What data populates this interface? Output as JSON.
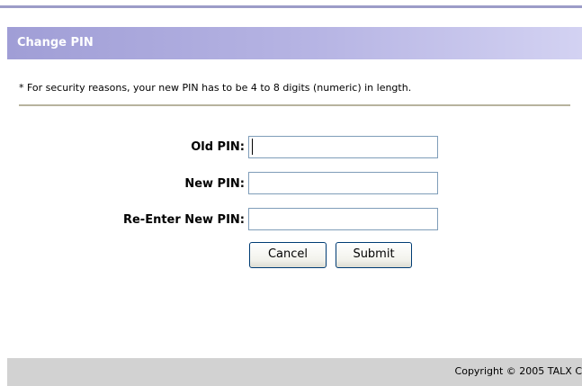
{
  "section": {
    "title": "Change PIN"
  },
  "note": "* For security reasons, your new PIN has to be 4 to 8 digits (numeric) in length.",
  "form": {
    "old_pin_label": "Old PIN:",
    "old_pin_value": "",
    "new_pin_label": "New PIN:",
    "new_pin_value": "",
    "reenter_label": "Re-Enter New PIN:",
    "reenter_value": ""
  },
  "buttons": {
    "cancel": "Cancel",
    "submit": "Submit"
  },
  "footer": {
    "copyright": "Copyright © 2005 TALX C"
  }
}
